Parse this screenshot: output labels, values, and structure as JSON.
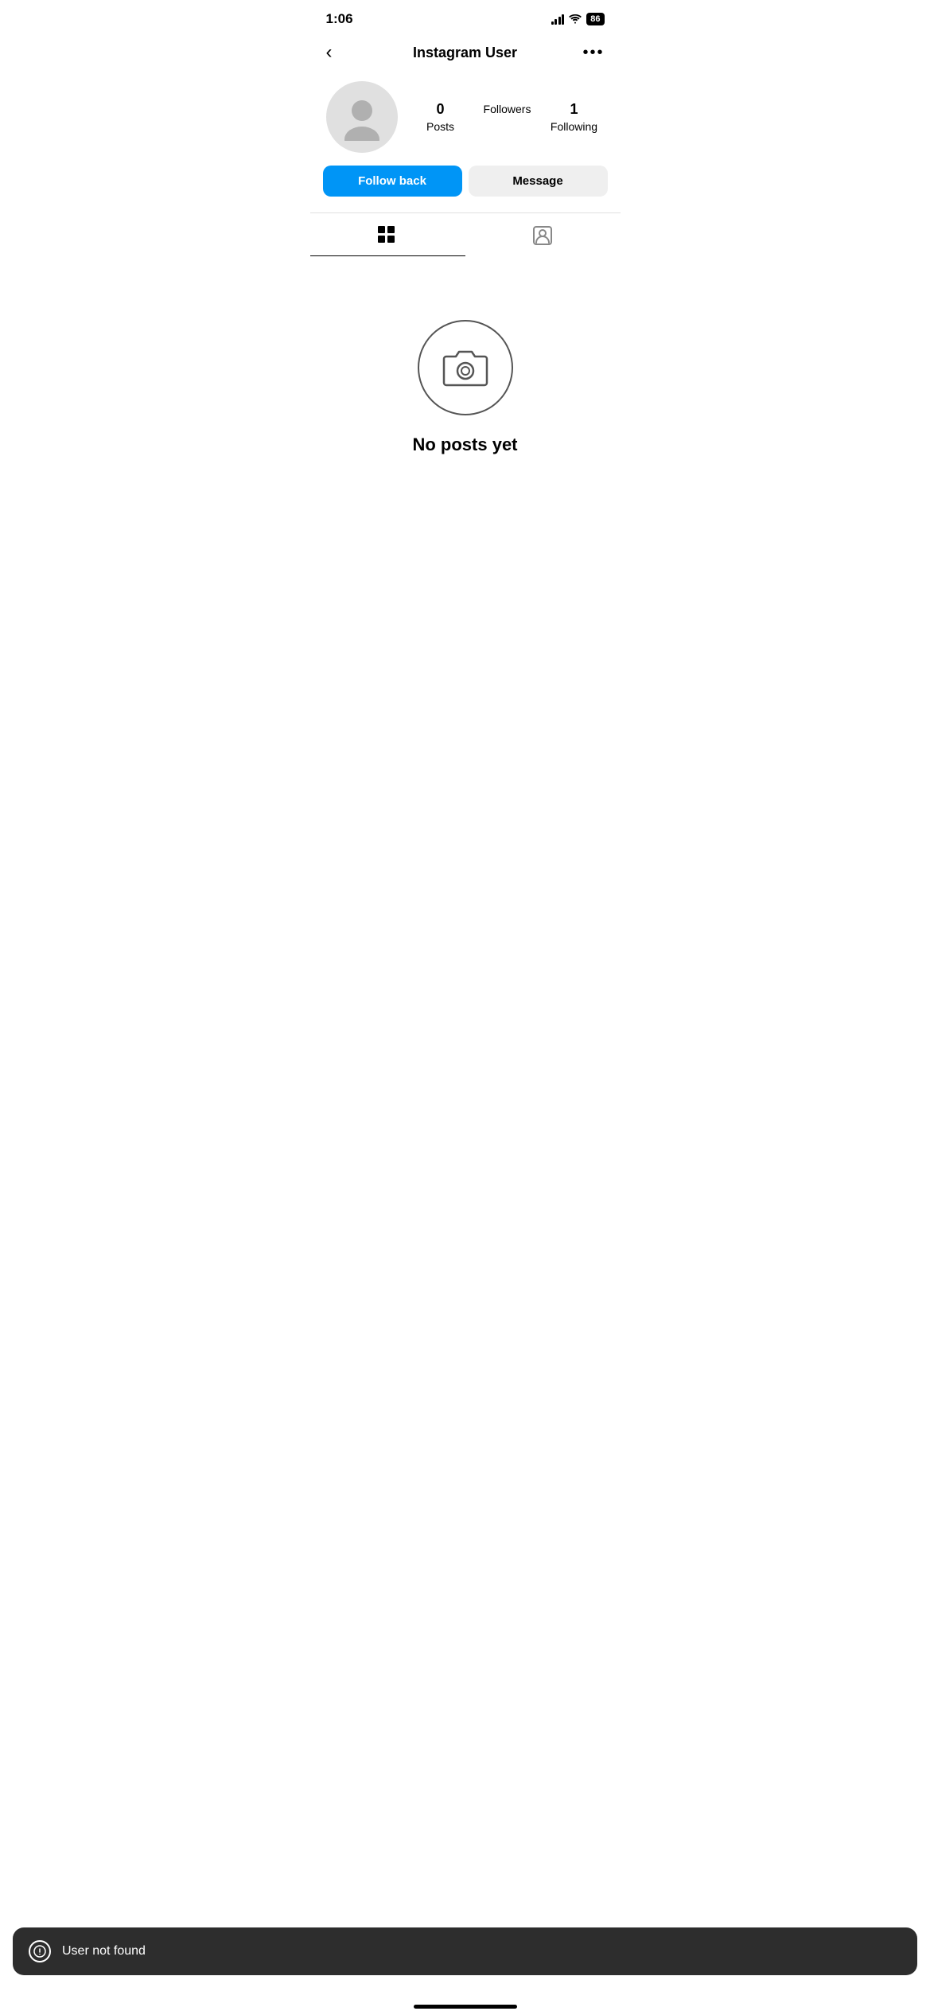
{
  "statusBar": {
    "time": "1:06",
    "battery": "86"
  },
  "navBar": {
    "title": "Instagram User",
    "backIcon": "‹",
    "moreIcon": "···"
  },
  "profile": {
    "stats": {
      "posts": {
        "count": "0",
        "label": "Posts"
      },
      "followers": {
        "label": "Followers"
      },
      "following": {
        "count": "1",
        "label": "Following"
      }
    }
  },
  "buttons": {
    "followBack": "Follow back",
    "message": "Message"
  },
  "tabs": {
    "grid": "Grid",
    "tagged": "Tagged"
  },
  "emptyState": {
    "text": "No posts yet"
  },
  "toast": {
    "text": "User not found"
  }
}
